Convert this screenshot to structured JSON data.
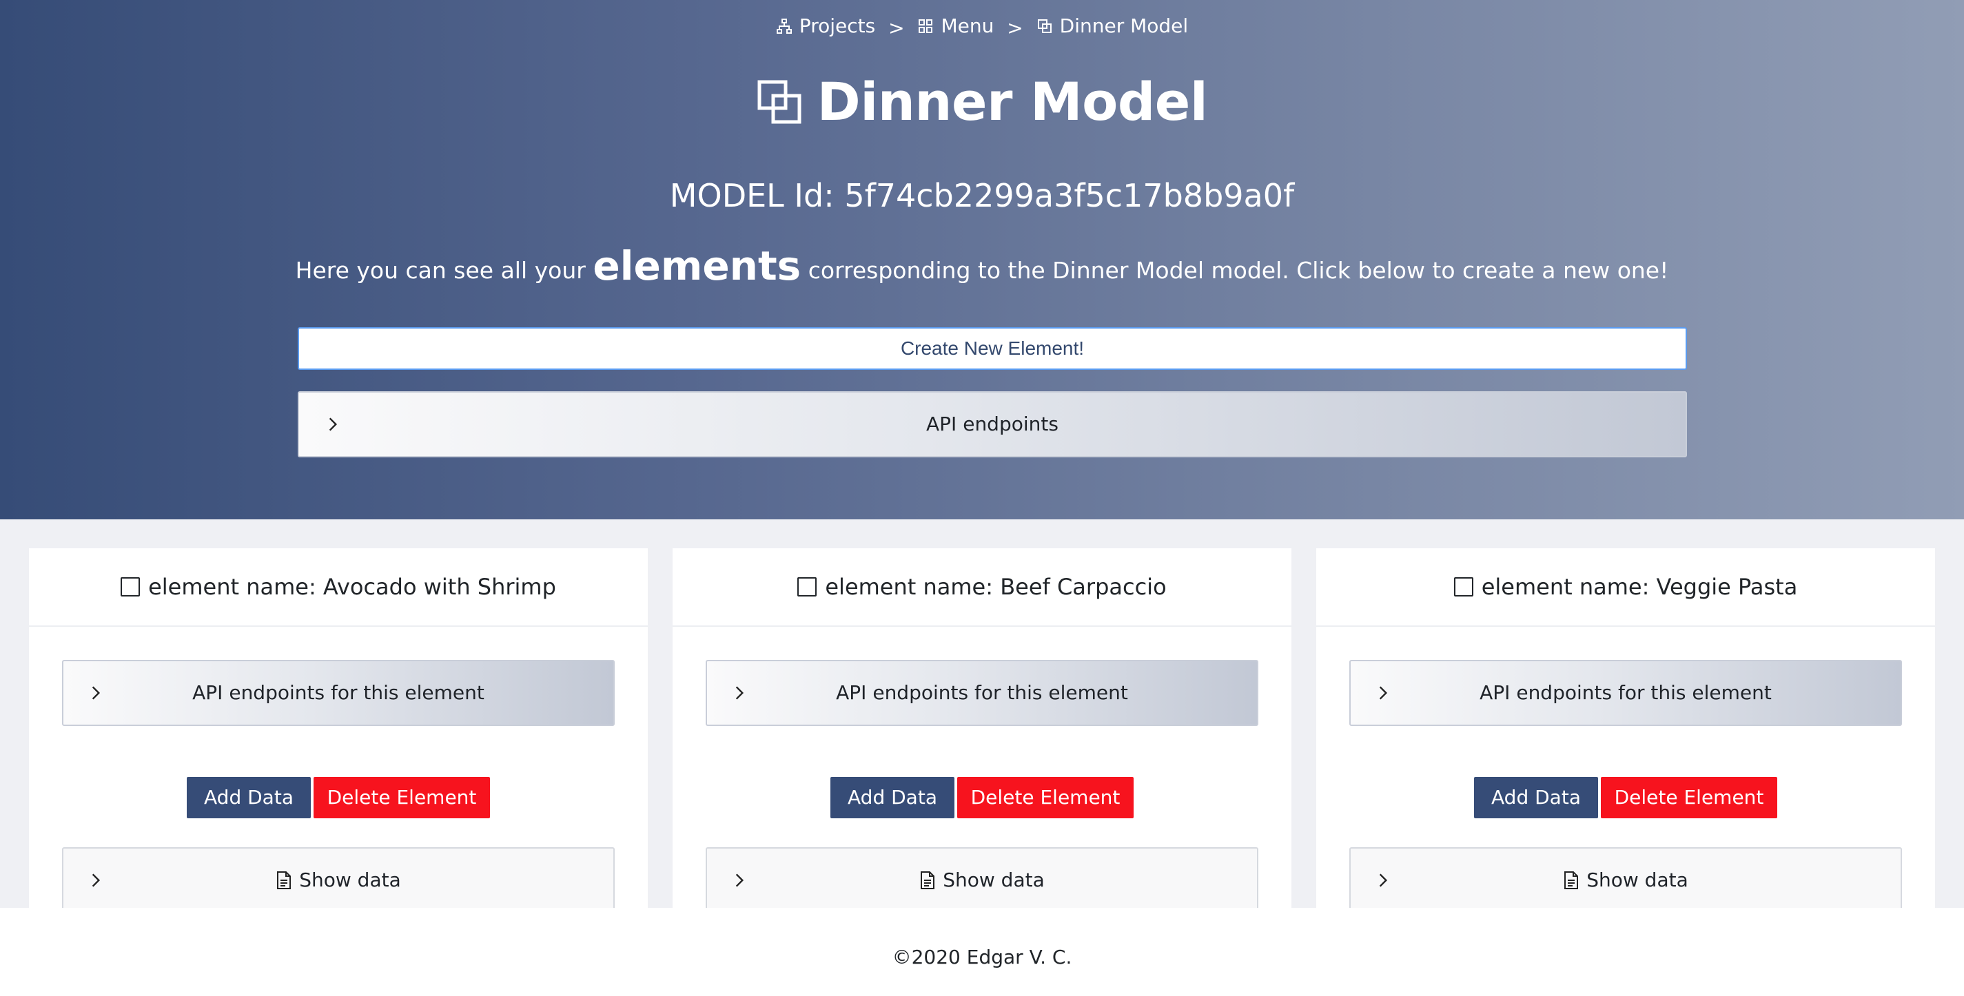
{
  "breadcrumb": {
    "projects": "Projects",
    "menu": "Menu",
    "current": "Dinner Model",
    "separator": ">"
  },
  "header": {
    "title": "Dinner Model",
    "model_id": "MODEL Id: 5f74cb2299a3f5c17b8b9a0f",
    "intro_before": "Here you can see all your",
    "intro_emphasis": "elements",
    "intro_after": "corresponding to the Dinner Model model. Click below to create a new one!"
  },
  "actions": {
    "create_label": "Create New Element!",
    "api_label": "API endpoints"
  },
  "elements": [
    {
      "name": "element name: Avocado with Shrimp",
      "api_label": "API endpoints for this element",
      "add_label": "Add Data",
      "delete_label": "Delete Element",
      "show_label": "Show data"
    },
    {
      "name": "element name: Beef Carpaccio",
      "api_label": "API endpoints for this element",
      "add_label": "Add Data",
      "delete_label": "Delete Element",
      "show_label": "Show data"
    },
    {
      "name": "element name: Veggie Pasta",
      "api_label": "API endpoints for this element",
      "add_label": "Add Data",
      "delete_label": "Delete Element",
      "show_label": "Show data"
    }
  ],
  "footer": {
    "text": "©2020 Edgar V. C."
  },
  "icons": {
    "projects": "sitemap-icon",
    "menu": "grid-icon",
    "model": "clone-icon",
    "expand": "chevron-right-icon",
    "checkbox": "checkbox-icon",
    "document": "document-icon"
  },
  "colors": {
    "hero_start": "#364c77",
    "hero_end": "#919db5",
    "primary": "#364c77",
    "danger": "#f7131e",
    "focus_border": "#5a9bf0",
    "cards_bg": "#eff0f4"
  }
}
